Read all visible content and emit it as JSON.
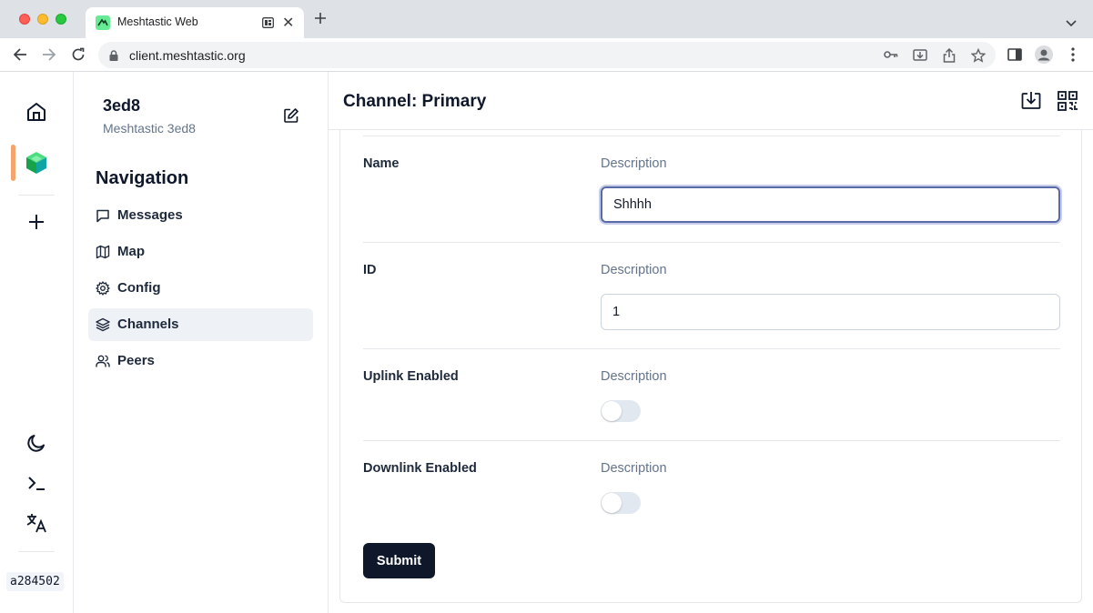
{
  "browser": {
    "tab_title": "Meshtastic Web",
    "url": "client.meshtastic.org",
    "colors": {
      "favicon": "#67ea94",
      "tabbar": "#dee1e6"
    }
  },
  "rail": {
    "icons": [
      "home-icon",
      "device-cube-icon",
      "plus-icon",
      "moon-icon",
      "terminal-icon",
      "language-icon"
    ],
    "version": "a284502",
    "colors": {
      "active_marker": "#f4a56b",
      "device_cube": "#22c55e"
    }
  },
  "sidebar": {
    "device_name": "3ed8",
    "device_subtitle": "Meshtastic 3ed8",
    "nav_heading": "Navigation",
    "items": [
      {
        "label": "Messages",
        "icon": "message-icon",
        "active": false
      },
      {
        "label": "Map",
        "icon": "map-icon",
        "active": false
      },
      {
        "label": "Config",
        "icon": "gear-icon",
        "active": false
      },
      {
        "label": "Channels",
        "icon": "layers-icon",
        "active": true
      },
      {
        "label": "Peers",
        "icon": "users-icon",
        "active": false
      }
    ]
  },
  "main": {
    "title": "Channel: Primary",
    "header_icons": [
      "download-icon",
      "qr-code-icon"
    ],
    "fields": [
      {
        "label": "Name",
        "description": "Description",
        "type": "text",
        "value": "Shhhh",
        "focused": true
      },
      {
        "label": "ID",
        "description": "Description",
        "type": "text",
        "value": "1",
        "focused": false
      },
      {
        "label": "Uplink Enabled",
        "description": "Description",
        "type": "toggle",
        "value": false
      },
      {
        "label": "Downlink Enabled",
        "description": "Description",
        "type": "toggle",
        "value": false
      }
    ],
    "submit_label": "Submit",
    "colors": {
      "primary_button": "#0f172a",
      "focus_ring": "#5a6aa8"
    }
  }
}
